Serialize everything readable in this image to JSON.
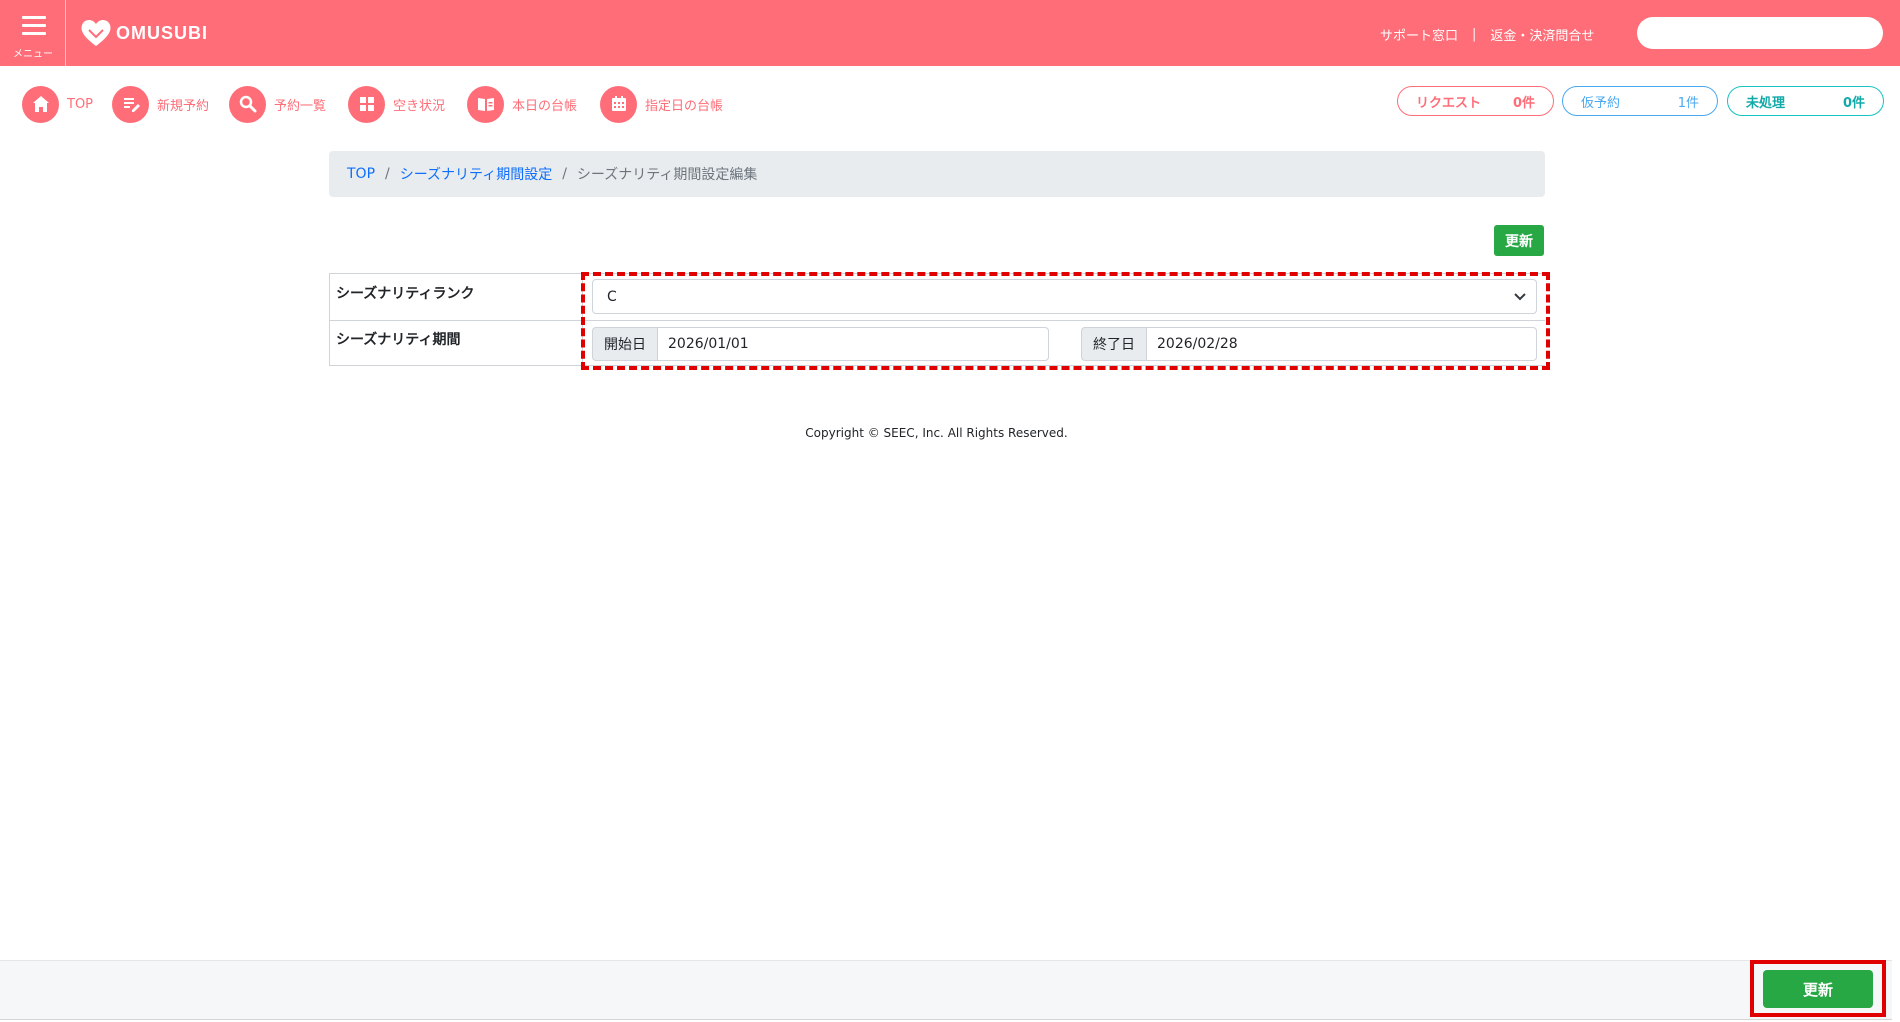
{
  "header": {
    "menu_label": "メニュー",
    "logo_text": "OMUSUBI",
    "support_link": "サポート窓口",
    "link_separator": "|",
    "refund_link": "返金・決済問合せ",
    "search_placeholder": ""
  },
  "nav": {
    "items": [
      {
        "label": "TOP",
        "icon": "home-icon"
      },
      {
        "label": "新規予約",
        "icon": "edit-icon"
      },
      {
        "label": "予約一覧",
        "icon": "search-icon"
      },
      {
        "label": "空き状況",
        "icon": "grid-icon"
      },
      {
        "label": "本日の台帳",
        "icon": "book-icon"
      },
      {
        "label": "指定日の台帳",
        "icon": "calendar-icon"
      }
    ]
  },
  "status_pills": {
    "request": {
      "label": "リクエスト",
      "count": "0件"
    },
    "tentative": {
      "label": "仮予約",
      "count": "1件"
    },
    "unprocessed": {
      "label": "未処理",
      "count": "0件"
    }
  },
  "breadcrumb": {
    "top": "TOP",
    "separator": "/",
    "parent": "シーズナリティ期間設定",
    "current": "シーズナリティ期間設定編集"
  },
  "form": {
    "update_button": "更新",
    "rank_label": "シーズナリティランク",
    "rank_value": "C",
    "period_label": "シーズナリティ期間",
    "start_label": "開始日",
    "start_value": "2026/01/01",
    "end_label": "終了日",
    "end_value": "2026/02/28"
  },
  "footer": {
    "copyright": "Copyright © SEEC, Inc. All Rights Reserved.",
    "update_button": "更新"
  },
  "colors": {
    "brand": "#ff6d78",
    "primary_link": "#0d6efd",
    "success": "#28a745",
    "highlight": "#e00000"
  }
}
